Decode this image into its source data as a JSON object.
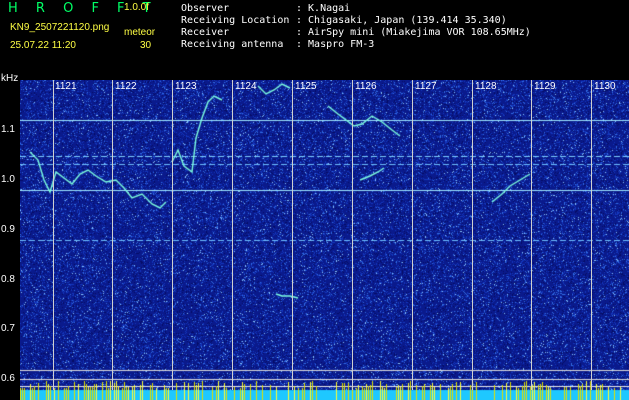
{
  "header": {
    "app_title": "H R O F F T",
    "version": "1.0.0f",
    "filename": "KN9_2507221120.png",
    "datetime": "25.07.22 11:20",
    "meteor_label": "meteor",
    "meteor_count": "30"
  },
  "station": [
    {
      "key": "Observer",
      "value": ": K.Nagai"
    },
    {
      "key": "Receiving Location",
      "value": ": Chigasaki, Japan (139.414 35.340)"
    },
    {
      "key": "Receiver",
      "value": ": AirSpy mini (Miakejima VOR 108.65MHz)"
    },
    {
      "key": "Receiving antenna",
      "value": ": Maspro FM-3"
    }
  ],
  "axis": {
    "y_unit": "kHz",
    "y_ticks": [
      "1.1",
      "1.0",
      "0.9",
      "0.8",
      "0.7",
      "0.6"
    ],
    "x_ticks": [
      "1121",
      "1122",
      "1123",
      "1124",
      "1125",
      "1126",
      "1127",
      "1128",
      "1129",
      "1130"
    ]
  },
  "colors": {
    "background": "#000000",
    "waterfall_base": "#0a1a8c",
    "noise_light": "#3a7bff",
    "signal": "#7dffe0",
    "title": "#00ff66",
    "label": "#ffff44"
  }
}
